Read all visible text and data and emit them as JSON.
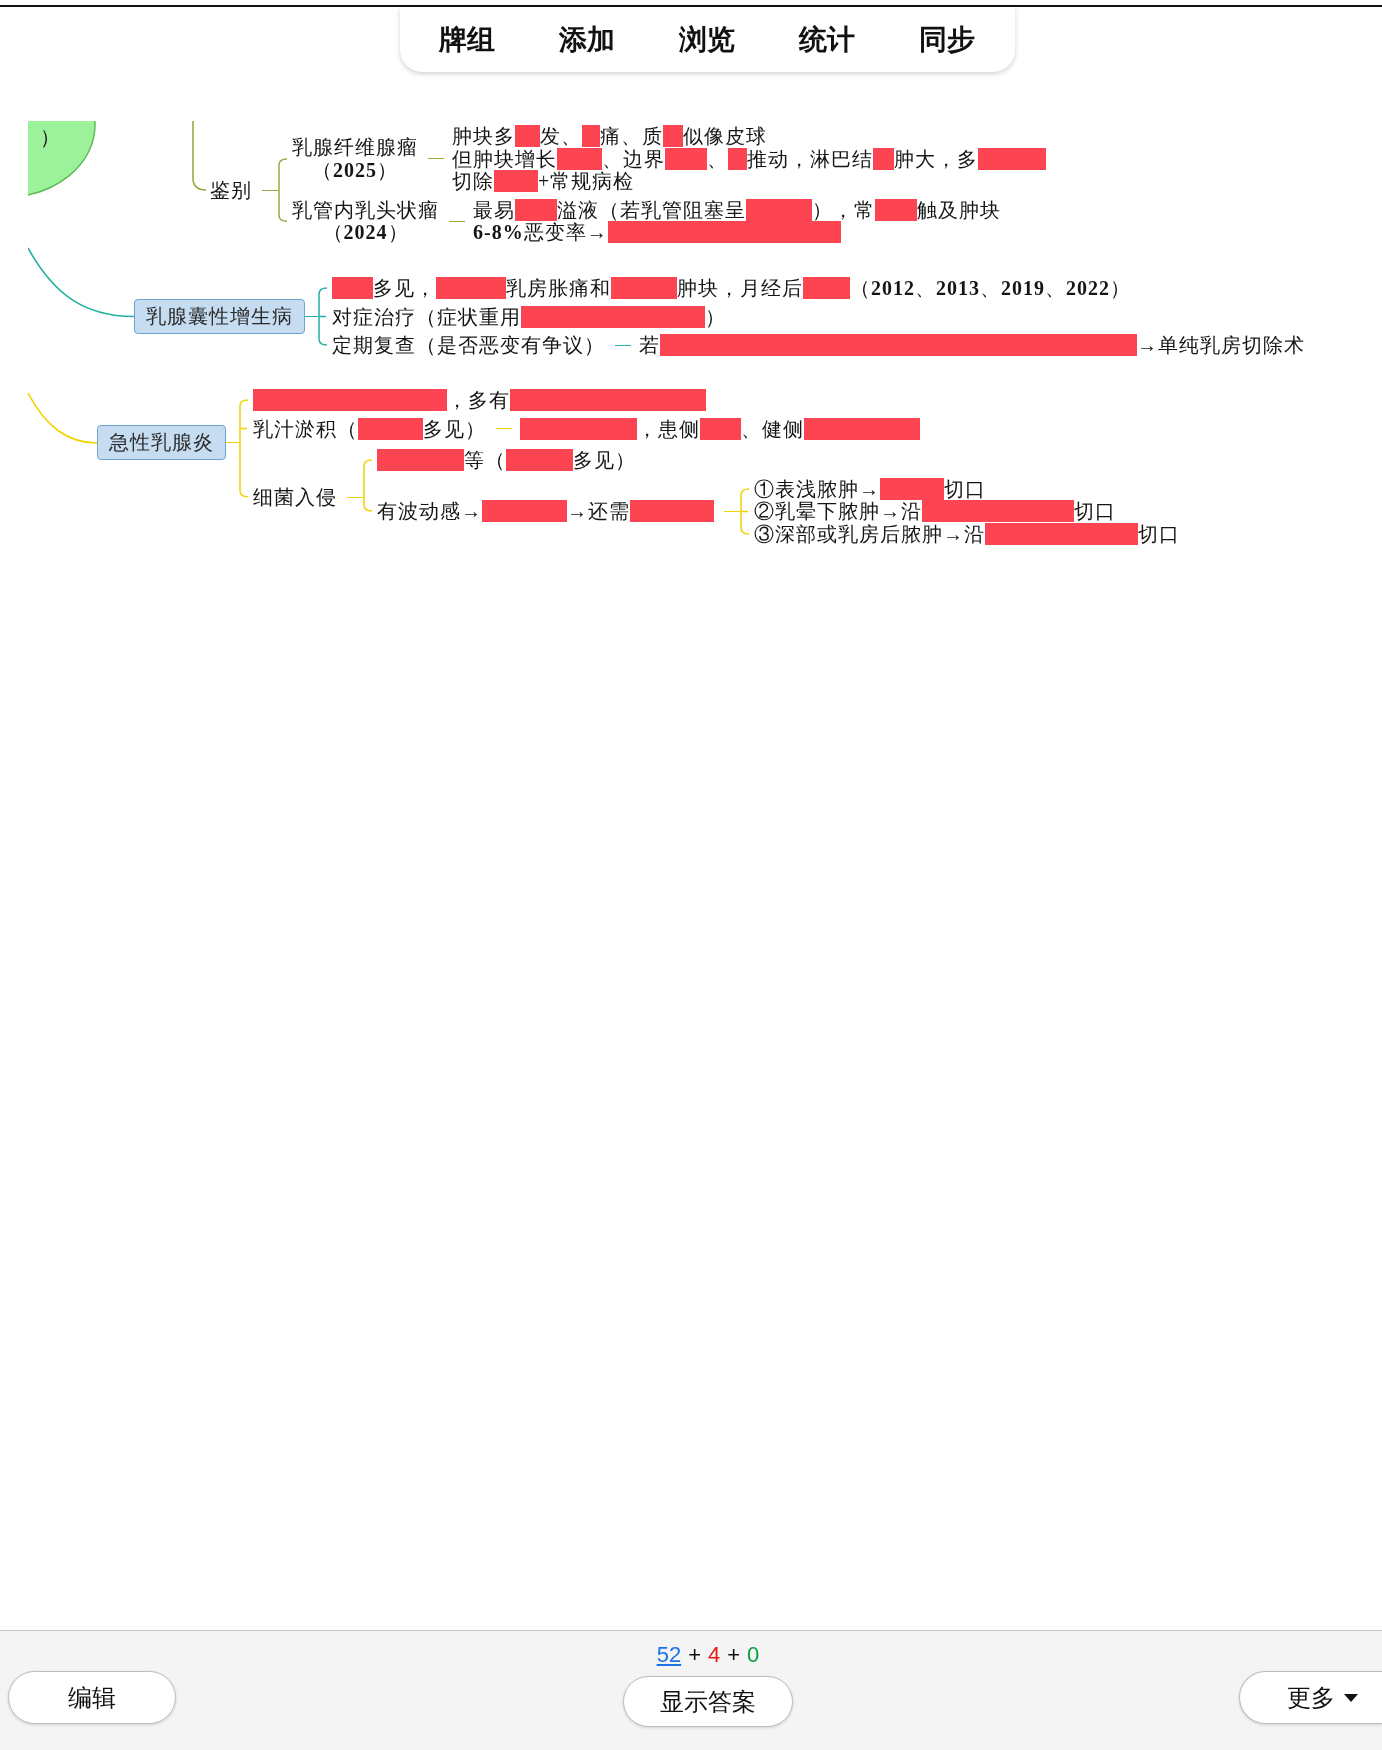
{
  "nav": {
    "tabs": [
      {
        "label": "牌组"
      },
      {
        "label": "添加"
      },
      {
        "label": "浏览"
      },
      {
        "label": "统计"
      },
      {
        "label": "同步"
      }
    ]
  },
  "mind_map": {
    "root": {
      "label": "）"
    },
    "sections": [
      {
        "kind": "plain",
        "label": "鉴别",
        "color": "#9aaa3c",
        "children": [
          {
            "kind": "titled",
            "label": "乳腺纤维腺瘤",
            "year": "（**2025**）",
            "children": [
              {
                "kind": "lines",
                "lines": [
                  [
                    {
                      "kind": "text",
                      "text": "肿块多"
                    },
                    {
                      "kind": "mask"
                    },
                    {
                      "kind": "text",
                      "text": "发、"
                    },
                    {
                      "kind": "mask"
                    },
                    {
                      "kind": "text",
                      "text": "痛、质"
                    },
                    {
                      "kind": "mask"
                    },
                    {
                      "kind": "text",
                      "text": "似像皮球"
                    }
                  ],
                  [
                    {
                      "kind": "text",
                      "text": "但肿块增长"
                    },
                    {
                      "kind": "mask"
                    },
                    {
                      "kind": "text",
                      "text": "、边界"
                    },
                    {
                      "kind": "mask"
                    },
                    {
                      "kind": "text",
                      "text": "、"
                    },
                    {
                      "kind": "mask"
                    },
                    {
                      "kind": "text",
                      "text": "推动，淋巴结"
                    },
                    {
                      "kind": "mask"
                    },
                    {
                      "kind": "text",
                      "text": "肿大，多"
                    },
                    {
                      "kind": "mask"
                    }
                  ],
                  [
                    {
                      "kind": "text",
                      "text": "切除"
                    },
                    {
                      "kind": "mask"
                    },
                    {
                      "kind": "text",
                      "text": "+常规病检"
                    }
                  ]
                ]
              }
            ]
          },
          {
            "kind": "titled",
            "label": "乳管内乳头状瘤",
            "year": "（**2024**）",
            "children": [
              {
                "kind": "lines",
                "lines": [
                  [
                    {
                      "kind": "text",
                      "text": "最易"
                    },
                    {
                      "kind": "mask"
                    },
                    {
                      "kind": "text",
                      "text": "溢液（若乳管阻塞呈"
                    },
                    {
                      "kind": "mask"
                    },
                    {
                      "kind": "text",
                      "text": "），常"
                    },
                    {
                      "kind": "mask"
                    },
                    {
                      "kind": "text",
                      "text": "触及肿块"
                    }
                  ],
                  [
                    {
                      "kind": "text",
                      "text": "**6-8%**恶变率→"
                    },
                    {
                      "kind": "mask"
                    }
                  ]
                ]
              }
            ]
          }
        ]
      },
      {
        "kind": "box",
        "label": "乳腺囊性增生病",
        "color": "#22b0a2",
        "children": [
          {
            "kind": "lines",
            "lines": [
              [
                {
                  "kind": "mask"
                },
                {
                  "kind": "text",
                  "text": "多见，"
                },
                {
                  "kind": "mask"
                },
                {
                  "kind": "text",
                  "text": "乳房胀痛和"
                },
                {
                  "kind": "mask"
                },
                {
                  "kind": "text",
                  "text": "肿块，月经后"
                },
                {
                  "kind": "mask"
                },
                {
                  "kind": "text",
                  "text": "（**2012**、**2013**、**2019**、**2022**）"
                }
              ]
            ]
          },
          {
            "kind": "lines",
            "lines": [
              [
                {
                  "kind": "text",
                  "text": "对症治疗（症状重用"
                },
                {
                  "kind": "mask"
                },
                {
                  "kind": "text",
                  "text": "）"
                }
              ]
            ]
          },
          {
            "kind": "lines",
            "lines": [
              [
                {
                  "kind": "text",
                  "text": "定期复查（是否恶变有争议）"
                }
              ]
            ],
            "children": [
              {
                "kind": "lines",
                "lines": [
                  [
                    {
                      "kind": "text",
                      "text": "若"
                    },
                    {
                      "kind": "mask"
                    },
                    {
                      "kind": "text",
                      "text": "→单纯乳房切除术"
                    }
                  ]
                ]
              }
            ]
          }
        ]
      },
      {
        "kind": "box",
        "label": "急性乳腺炎",
        "color": "#f0d400",
        "children": [
          {
            "kind": "lines",
            "lines": [
              [
                {
                  "kind": "mask"
                },
                {
                  "kind": "text",
                  "text": "，多有"
                },
                {
                  "kind": "mask"
                }
              ]
            ]
          },
          {
            "kind": "lines",
            "lines": [
              [
                {
                  "kind": "text",
                  "text": "乳汁淤积（"
                },
                {
                  "kind": "mask"
                },
                {
                  "kind": "text",
                  "text": "多见）"
                }
              ]
            ],
            "children": [
              {
                "kind": "lines",
                "lines": [
                  [
                    {
                      "kind": "mask"
                    },
                    {
                      "kind": "text",
                      "text": "，患侧"
                    },
                    {
                      "kind": "mask"
                    },
                    {
                      "kind": "text",
                      "text": "、健侧"
                    },
                    {
                      "kind": "mask"
                    }
                  ]
                ]
              }
            ]
          },
          {
            "kind": "plain",
            "label": "细菌入侵",
            "children": [
              {
                "kind": "lines",
                "lines": [
                  [
                    {
                      "kind": "mask"
                    },
                    {
                      "kind": "text",
                      "text": "等（"
                    },
                    {
                      "kind": "mask"
                    },
                    {
                      "kind": "text",
                      "text": "多见）"
                    }
                  ]
                ]
              },
              {
                "kind": "lines",
                "lines": [
                  [
                    {
                      "kind": "text",
                      "text": "有波动感→"
                    },
                    {
                      "kind": "mask"
                    },
                    {
                      "kind": "text",
                      "text": "→还需"
                    },
                    {
                      "kind": "mask"
                    }
                  ]
                ],
                "children": [
                  {
                    "kind": "lines",
                    "lines": [
                      [
                        {
                          "kind": "text",
                          "text": "①表浅脓肿→"
                        },
                        {
                          "kind": "mask"
                        },
                        {
                          "kind": "text",
                          "text": "切口"
                        }
                      ]
                    ]
                  },
                  {
                    "kind": "lines",
                    "lines": [
                      [
                        {
                          "kind": "text",
                          "text": "②乳晕下脓肿→沿"
                        },
                        {
                          "kind": "mask"
                        },
                        {
                          "kind": "text",
                          "text": "切口"
                        }
                      ]
                    ]
                  },
                  {
                    "kind": "lines",
                    "lines": [
                      [
                        {
                          "kind": "text",
                          "text": "③深部或乳房后脓肿→沿"
                        },
                        {
                          "kind": "mask"
                        },
                        {
                          "kind": "text",
                          "text": "切口"
                        }
                      ]
                    ]
                  }
                ]
              }
            ]
          }
        ]
      }
    ]
  },
  "footer": {
    "counts": [
      {
        "kind": "new",
        "value": "52",
        "current": true
      },
      {
        "kind": "learn",
        "value": "4",
        "current": false
      },
      {
        "kind": "review",
        "value": "0",
        "current": false
      }
    ],
    "separators": [
      "+",
      "+"
    ],
    "edit_button": {
      "label": "编辑"
    },
    "answer_button": {
      "label": "显示答案"
    },
    "more_button": {
      "label": "更多"
    }
  }
}
